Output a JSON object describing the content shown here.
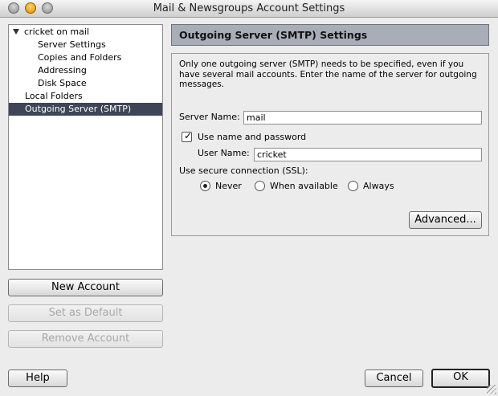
{
  "window": {
    "title": "Mail & Newsgroups Account Settings"
  },
  "tree": {
    "root_label": "cricket on mail",
    "items": [
      {
        "label": "Server Settings"
      },
      {
        "label": "Copies and Folders"
      },
      {
        "label": "Addressing"
      },
      {
        "label": "Disk Space"
      }
    ],
    "local_folders": "Local Folders",
    "outgoing": "Outgoing Server (SMTP)"
  },
  "left_buttons": {
    "new_account": "New Account",
    "set_default": "Set as Default",
    "remove_account": "Remove Account"
  },
  "panel": {
    "header": "Outgoing Server (SMTP) Settings",
    "description": "Only one outgoing server (SMTP) needs to be specified, even if you have several mail accounts. Enter the name of the server for outgoing messages.",
    "server_name_label": "Server Name:",
    "server_name_value": "mail",
    "use_name_password_label": "Use name and password",
    "use_name_password_checked": true,
    "user_name_label": "User Name:",
    "user_name_value": "cricket",
    "ssl_label": "Use secure connection (SSL):",
    "ssl_options": [
      {
        "label": "Never",
        "selected": true
      },
      {
        "label": "When available",
        "selected": false
      },
      {
        "label": "Always",
        "selected": false
      }
    ],
    "advanced_label": "Advanced..."
  },
  "footer": {
    "help": "Help",
    "cancel": "Cancel",
    "ok": "OK"
  }
}
